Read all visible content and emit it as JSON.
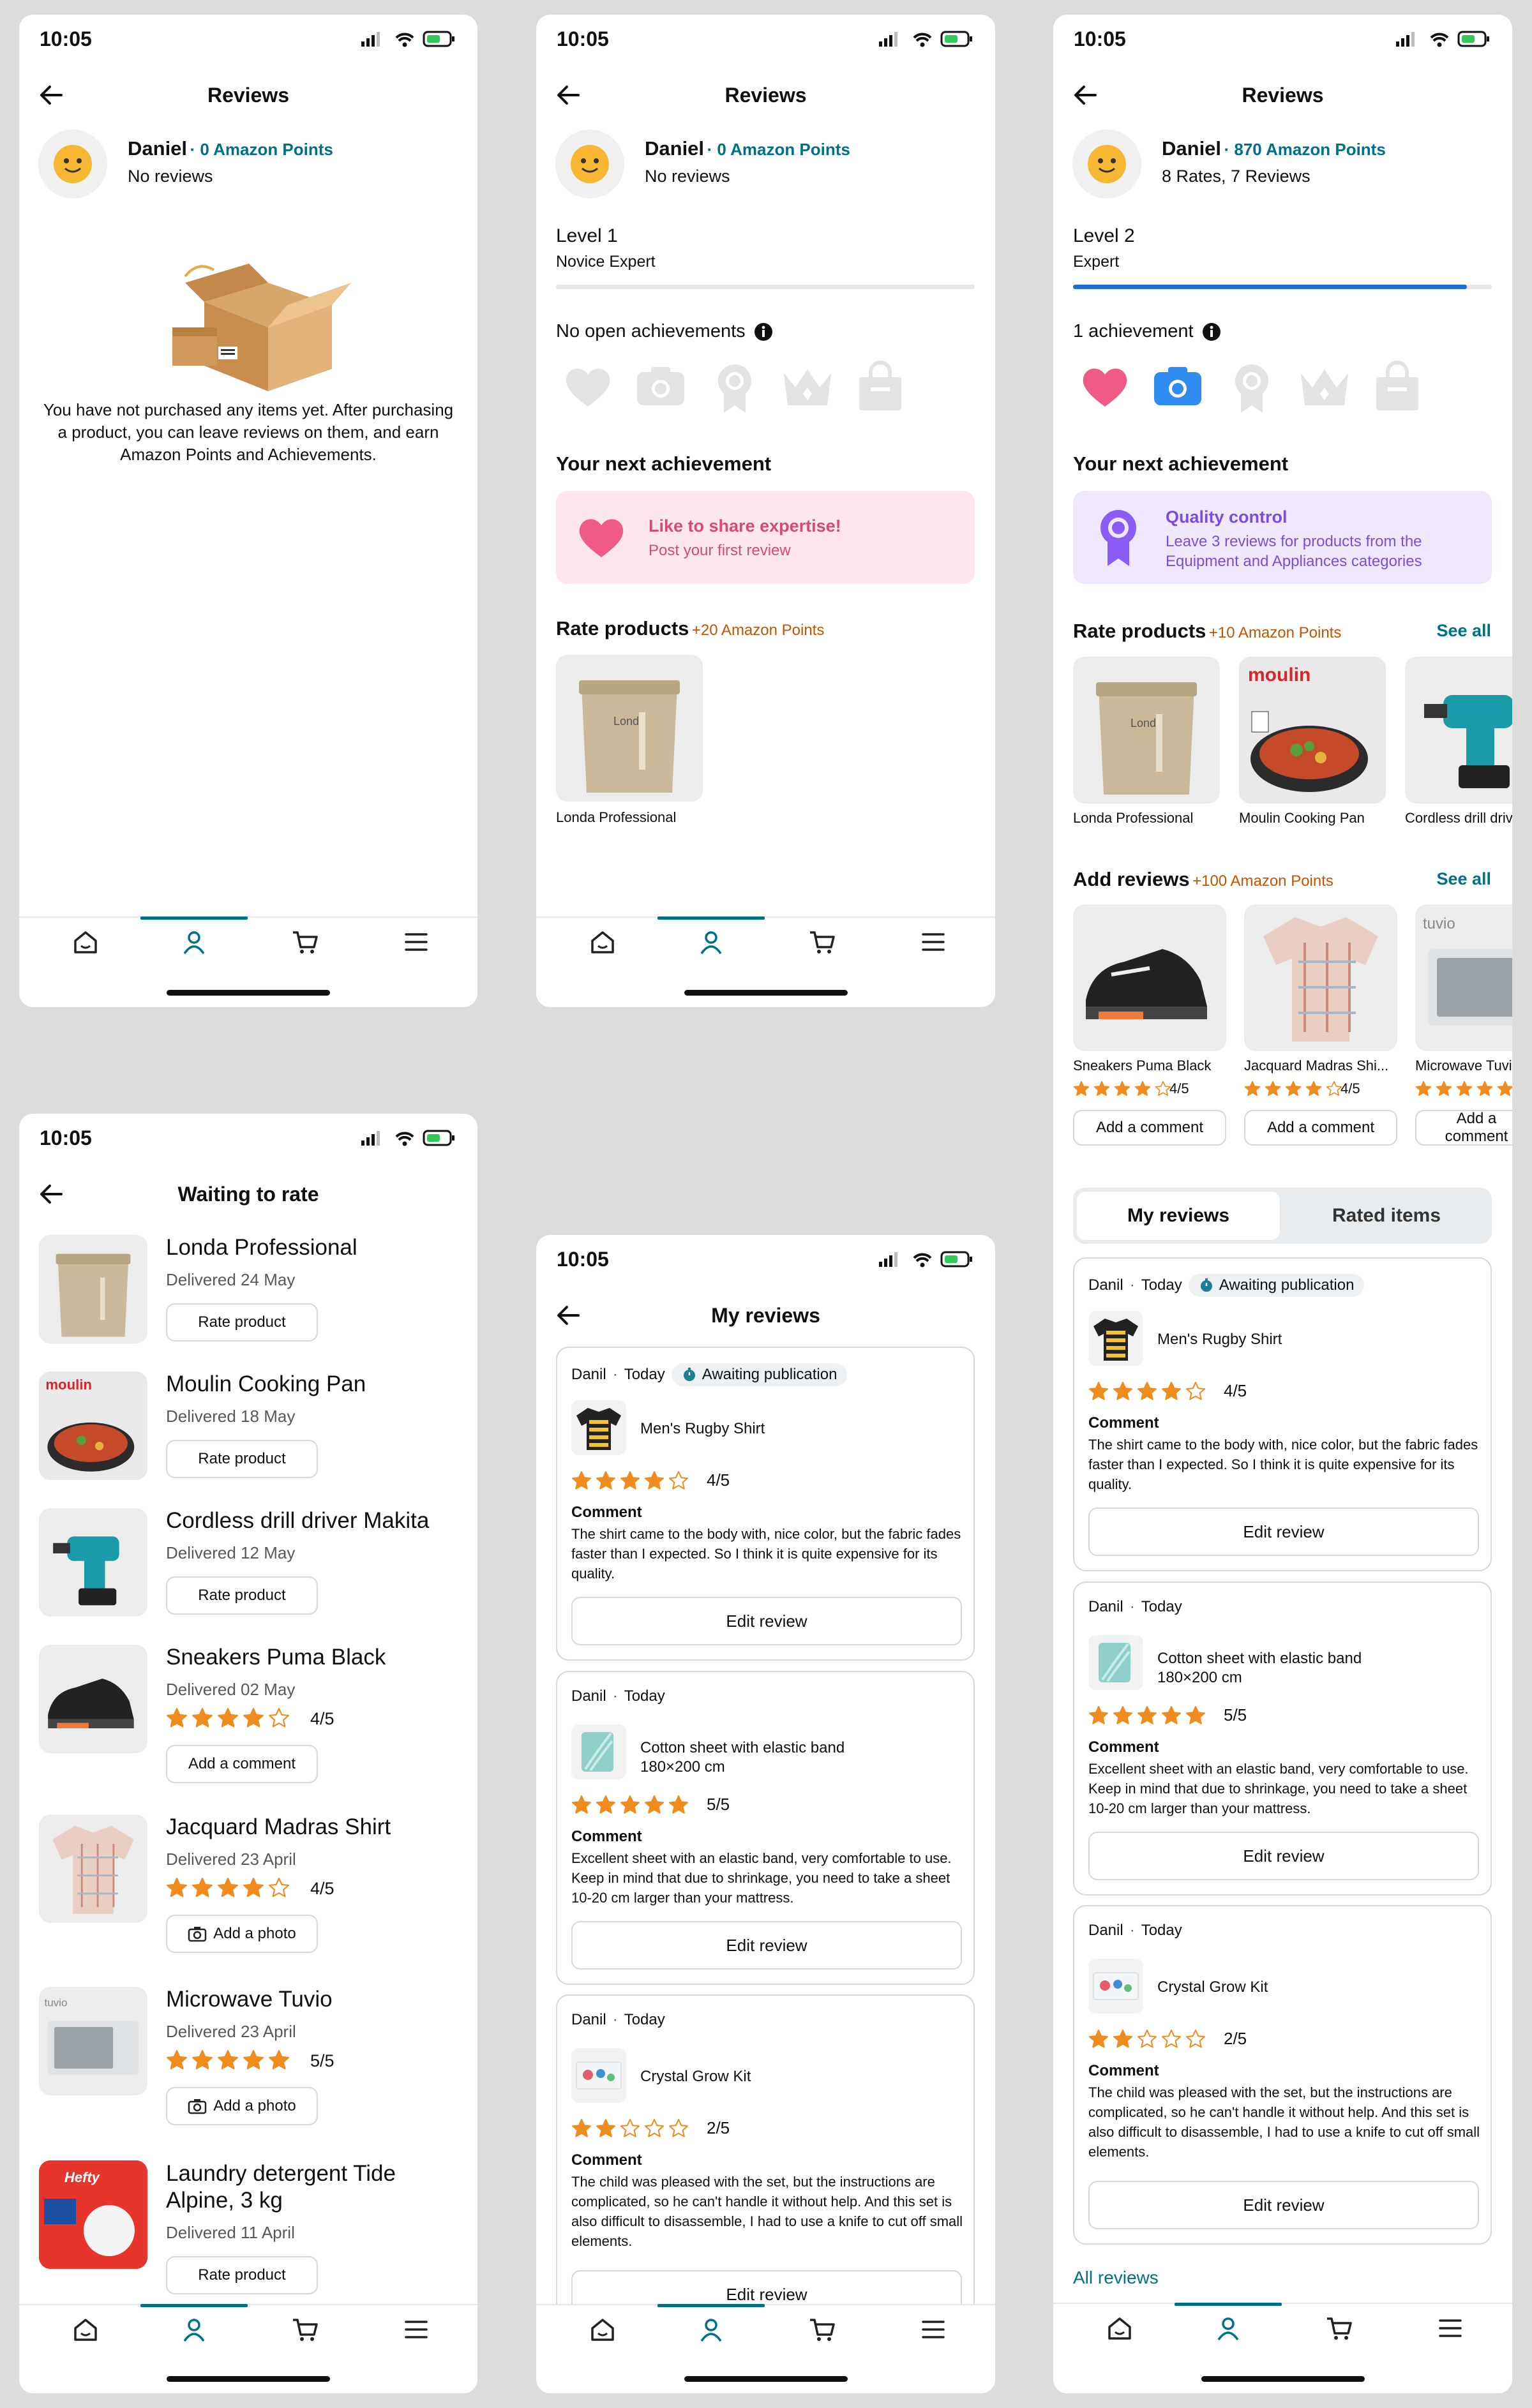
{
  "status": {
    "time": "10:05"
  },
  "screen1": {
    "title": "Reviews",
    "user": {
      "name": "Daniel",
      "points": "0 Amazon Points",
      "summary": "No reviews"
    },
    "empty_text": "You have not purchased any items yet. After purchasing a product, you can leave reviews on them, and earn Amazon Points and Achievements."
  },
  "screen2": {
    "title": "Reviews",
    "user": {
      "name": "Daniel",
      "points": "0 Amazon Points",
      "summary": "No reviews"
    },
    "level": {
      "title": "Level 1",
      "name": "Novice Expert",
      "progress": 0
    },
    "achievements_label": "No open achievements",
    "next_achievement_heading": "Your next achievement",
    "next_achievement": {
      "title": "Like to share expertise!",
      "desc": "Post your first review"
    },
    "rate_products": {
      "heading": "Rate products",
      "bonus": "+20 Amazon Points",
      "items": [
        "Londa Professional"
      ]
    }
  },
  "screen3": {
    "title": "Reviews",
    "user": {
      "name": "Daniel",
      "points": "870 Amazon Points",
      "summary": "8 Rates, 7 Reviews"
    },
    "level": {
      "title": "Level 2",
      "name": "Expert",
      "progress": 0.94
    },
    "achievements_label": "1 achievement",
    "next_achievement_heading": "Your next achievement",
    "next_achievement": {
      "title": "Quality control",
      "desc": "Leave 3 reviews for products from the Equipment and Appliances categories"
    },
    "rate_products": {
      "heading": "Rate products",
      "bonus": "+10 Amazon Points",
      "see_all": "See all",
      "items": [
        "Londa Professional",
        "Moulin Cooking Pan",
        "Cordless drill driver Makita"
      ]
    },
    "add_reviews": {
      "heading": "Add reviews",
      "bonus": "+100 Amazon Points",
      "see_all": "See all",
      "items": [
        {
          "name": "Sneakers Puma Black",
          "rating": 4,
          "score": "4/5",
          "button": "Add a comment"
        },
        {
          "name": "Jacquard Madras Shi...",
          "rating": 4,
          "score": "4/5",
          "button": "Add a comment"
        },
        {
          "name": "Microwave Tuvio",
          "rating": 5,
          "score": "5/5",
          "button": "Add a comment"
        }
      ]
    },
    "tabs": {
      "my_reviews": "My reviews",
      "rated_items": "Rated items"
    },
    "all_reviews": "All reviews"
  },
  "reviews": [
    {
      "author": "Danil",
      "date": "Today",
      "status": "Awaiting publication",
      "product": "Men's Rugby Shirt",
      "product2": "",
      "rating": 4,
      "score": "4/5",
      "comment_label": "Comment",
      "comment": "The shirt came to the body with, nice color, but the fabric fades faster than I expected. So I think it is quite expensive for its quality.",
      "button": "Edit review"
    },
    {
      "author": "Danil",
      "date": "Today",
      "status": "",
      "product": "Cotton sheet with elastic band",
      "product2": "180×200 cm",
      "rating": 5,
      "score": "5/5",
      "comment_label": "Comment",
      "comment": "Excellent sheet with an elastic band, very comfortable to use. Keep in mind that due to shrinkage, you need to take a sheet 10-20 cm larger than your mattress.",
      "button": "Edit review"
    },
    {
      "author": "Danil",
      "date": "Today",
      "status": "",
      "product": "Crystal Grow Kit",
      "product2": "",
      "rating": 2,
      "score": "2/5",
      "comment_label": "Comment",
      "comment": "The child was pleased with the set, but the instructions are complicated, so he can't handle it without help. And this set is also difficult to disassemble, I had to use a knife to cut off small elements.",
      "button": "Edit review"
    }
  ],
  "screen4": {
    "title": "Waiting to rate",
    "items": [
      {
        "name": "Londa Professional",
        "delivered": "Delivered 24 May",
        "button": "Rate product"
      },
      {
        "name": "Moulin Cooking Pan",
        "delivered": "Delivered 18 May",
        "button": "Rate product"
      },
      {
        "name": "Cordless drill driver Makita",
        "delivered": "Delivered 12 May",
        "button": "Rate product"
      },
      {
        "name": "Sneakers Puma Black",
        "delivered": "Delivered 02 May",
        "rating": 4,
        "score": "4/5",
        "button": "Add a comment"
      },
      {
        "name": "Jacquard Madras Shirt",
        "delivered": "Delivered 23 April",
        "rating": 4,
        "score": "4/5",
        "button": "Add a photo"
      },
      {
        "name": "Microwave Tuvio",
        "delivered": "Delivered 23 April",
        "rating": 5,
        "score": "5/5",
        "button": "Add a photo"
      },
      {
        "name": "Laundry detergent Tide Alpine, 3 kg",
        "delivered": "Delivered 11 April",
        "button": "Rate product"
      }
    ]
  },
  "screen5": {
    "title": "My reviews"
  },
  "colors": {
    "accent": "#007185",
    "star": "#f08b1d",
    "orange": "#c45500",
    "heart": "#f05a86",
    "camera": "#2f8cf0",
    "purple": "#8b5cf6"
  }
}
